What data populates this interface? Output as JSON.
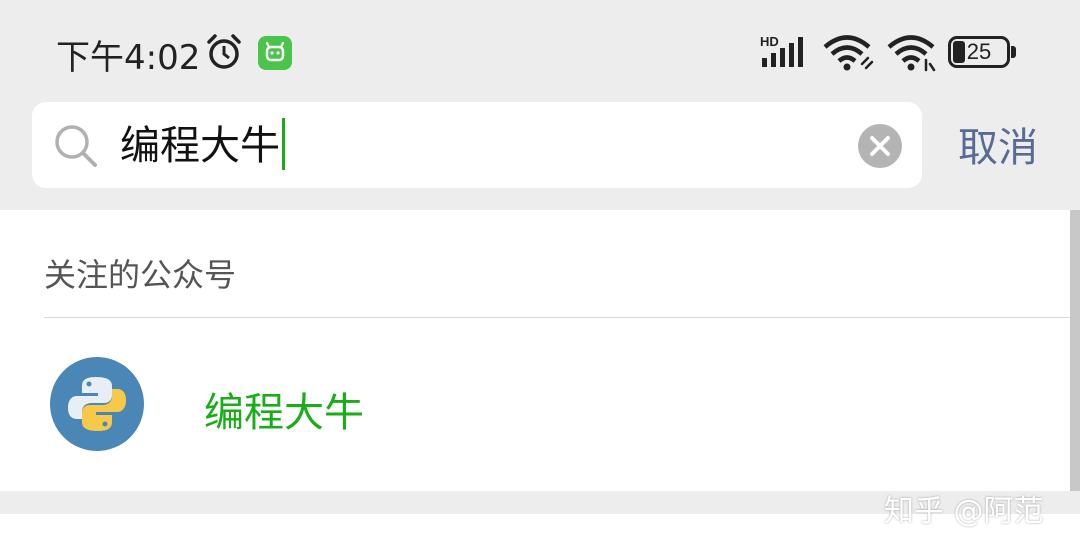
{
  "status_bar": {
    "time": "下午4:02",
    "network_label": "HD",
    "battery": "25",
    "icons": [
      "alarm-icon",
      "app-notification-icon",
      "signal-icon",
      "wifi-icon",
      "wifi-icon",
      "battery-icon"
    ]
  },
  "search": {
    "query": "编程大牛",
    "cancel_label": "取消"
  },
  "results": {
    "section_title": "关注的公众号",
    "items": [
      {
        "name": "编程大牛",
        "avatar_icon": "python-logo-icon"
      }
    ]
  },
  "watermark": "知乎 @阿范",
  "colors": {
    "accent_green": "#1aad19",
    "link_blue": "#576b95",
    "background": "#ededed"
  }
}
